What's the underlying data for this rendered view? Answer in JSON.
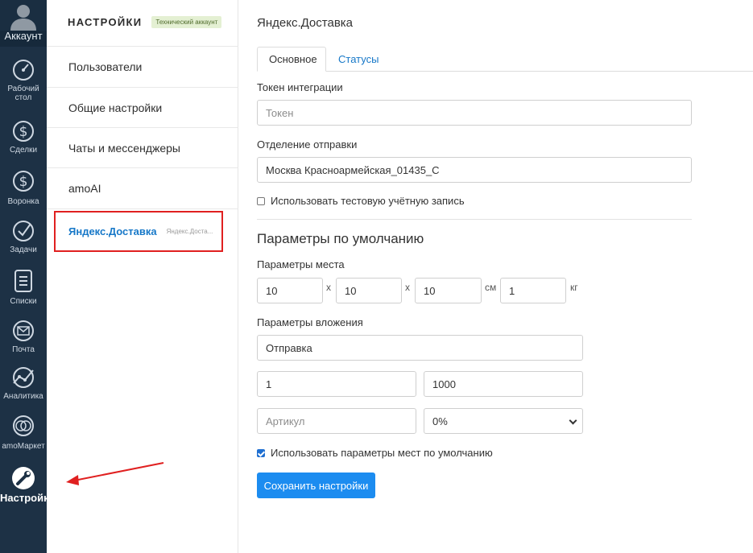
{
  "nav": {
    "items": [
      {
        "label": "Аккаунт",
        "icon": "account-icon"
      },
      {
        "label": "Рабочий стол",
        "line1": "Рабочий",
        "line2": "стол",
        "icon": "dashboard-icon"
      },
      {
        "label": "Сделки",
        "icon": "deals-icon"
      },
      {
        "label": "Воронка",
        "icon": "funnel-icon"
      },
      {
        "label": "Задачи",
        "icon": "tasks-icon"
      },
      {
        "label": "Списки",
        "icon": "lists-icon"
      },
      {
        "label": "Почта",
        "icon": "mail-icon"
      },
      {
        "label": "Аналитика",
        "icon": "analytics-icon"
      },
      {
        "label": "amoМаркет",
        "icon": "market-icon"
      },
      {
        "label": "Настройки",
        "icon": "settings-icon"
      }
    ]
  },
  "sidebar": {
    "title": "НАСТРОЙКИ",
    "badge": "Технический аккаунт",
    "items": [
      {
        "label": "Пользователи"
      },
      {
        "label": "Общие настройки"
      },
      {
        "label": "Чаты и мессенджеры"
      },
      {
        "label": "amoAI"
      },
      {
        "label": "Яндекс.Доставка",
        "sub": "Яндекс.Доста..."
      }
    ]
  },
  "main": {
    "title": "Яндекс.Доставка",
    "tabs": [
      {
        "label": "Основное"
      },
      {
        "label": "Статусы"
      }
    ],
    "token_label": "Токен интеграции",
    "token_placeholder": "Токен",
    "dept_label": "Отделение отправки",
    "dept_value": "Москва Красноармейская_01435_С",
    "test_account_label": "Использовать тестовую учётную запись",
    "defaults_title": "Параметры по умолчанию",
    "place_label": "Параметры места",
    "dim1": "10",
    "dim2": "10",
    "dim3": "10",
    "x_sym": "x",
    "cm_unit": "см",
    "weight": "1",
    "kg_unit": "кг",
    "attach_label": "Параметры вложения",
    "attach_name": "Отправка",
    "qty": "1",
    "price": "1000",
    "article_placeholder": "Артикул",
    "vat_selected": "0%",
    "use_defaults_label": "Использовать параметры мест по умолчанию",
    "save_label": "Сохранить настройки"
  },
  "colors": {
    "nav_bg": "#1d3145",
    "accent": "#1778c8",
    "button": "#1c8cf0",
    "highlight": "#e02020"
  }
}
